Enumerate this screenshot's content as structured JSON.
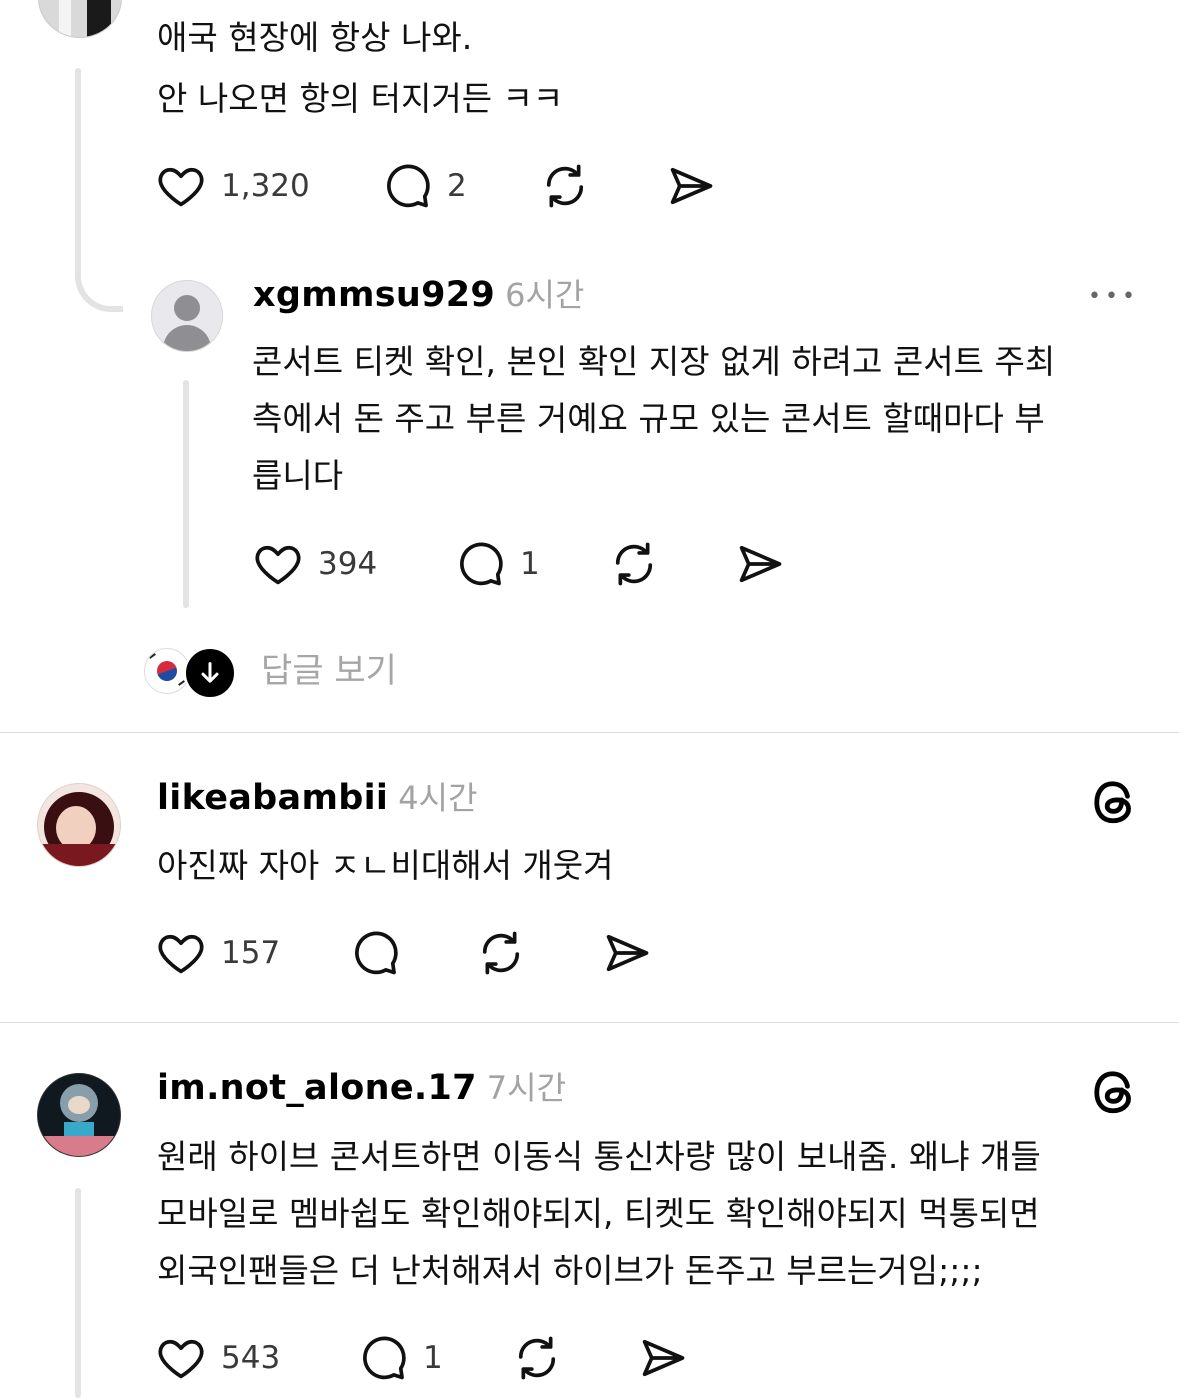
{
  "post1": {
    "lines": [
      "애국 현장에 항상 나와.",
      "안 나오면 항의 터지거든 ㅋㅋ"
    ],
    "likes": "1,320",
    "replies": "2"
  },
  "reply": {
    "username": "xgmmsu929",
    "time": "6시간",
    "more": "•••",
    "lines": [
      "콘서트 티켓 확인, 본인 확인 지장 없게 하려고 콘서트 주최",
      "측에서 돈 주고 부른 거예요 규모 있는 콘서트 할때마다 부",
      "릅니다"
    ],
    "likes": "394",
    "replies": "1",
    "view_replies": "답글 보기"
  },
  "post2": {
    "username": "likeabambii",
    "time": "4시간",
    "lines": [
      "아진짜 자아 ㅈㄴ비대해서 개웃겨"
    ],
    "likes": "157"
  },
  "post3": {
    "username": "im.not_alone.17",
    "time": "7시간",
    "lines": [
      "원래 하이브 콘서트하면 이동식 통신차량 많이 보내줌. 왜냐 걔들",
      "모바일로 멤바쉽도 확인해야되지, 티켓도 확인해야되지 먹통되면",
      "외국인팬들은 더 난처해져서 하이브가 돈주고 부르는거임;;;;"
    ],
    "likes": "543",
    "replies": "1"
  },
  "colors": {
    "divider": "#dcdcdc",
    "muted": "#a3a3a3",
    "thread_line": "#e3e3e3"
  },
  "icons": [
    "heart-icon",
    "comment-icon",
    "repost-icon",
    "share-icon",
    "threads-logo-icon",
    "arrow-down-icon",
    "flag-icon"
  ]
}
